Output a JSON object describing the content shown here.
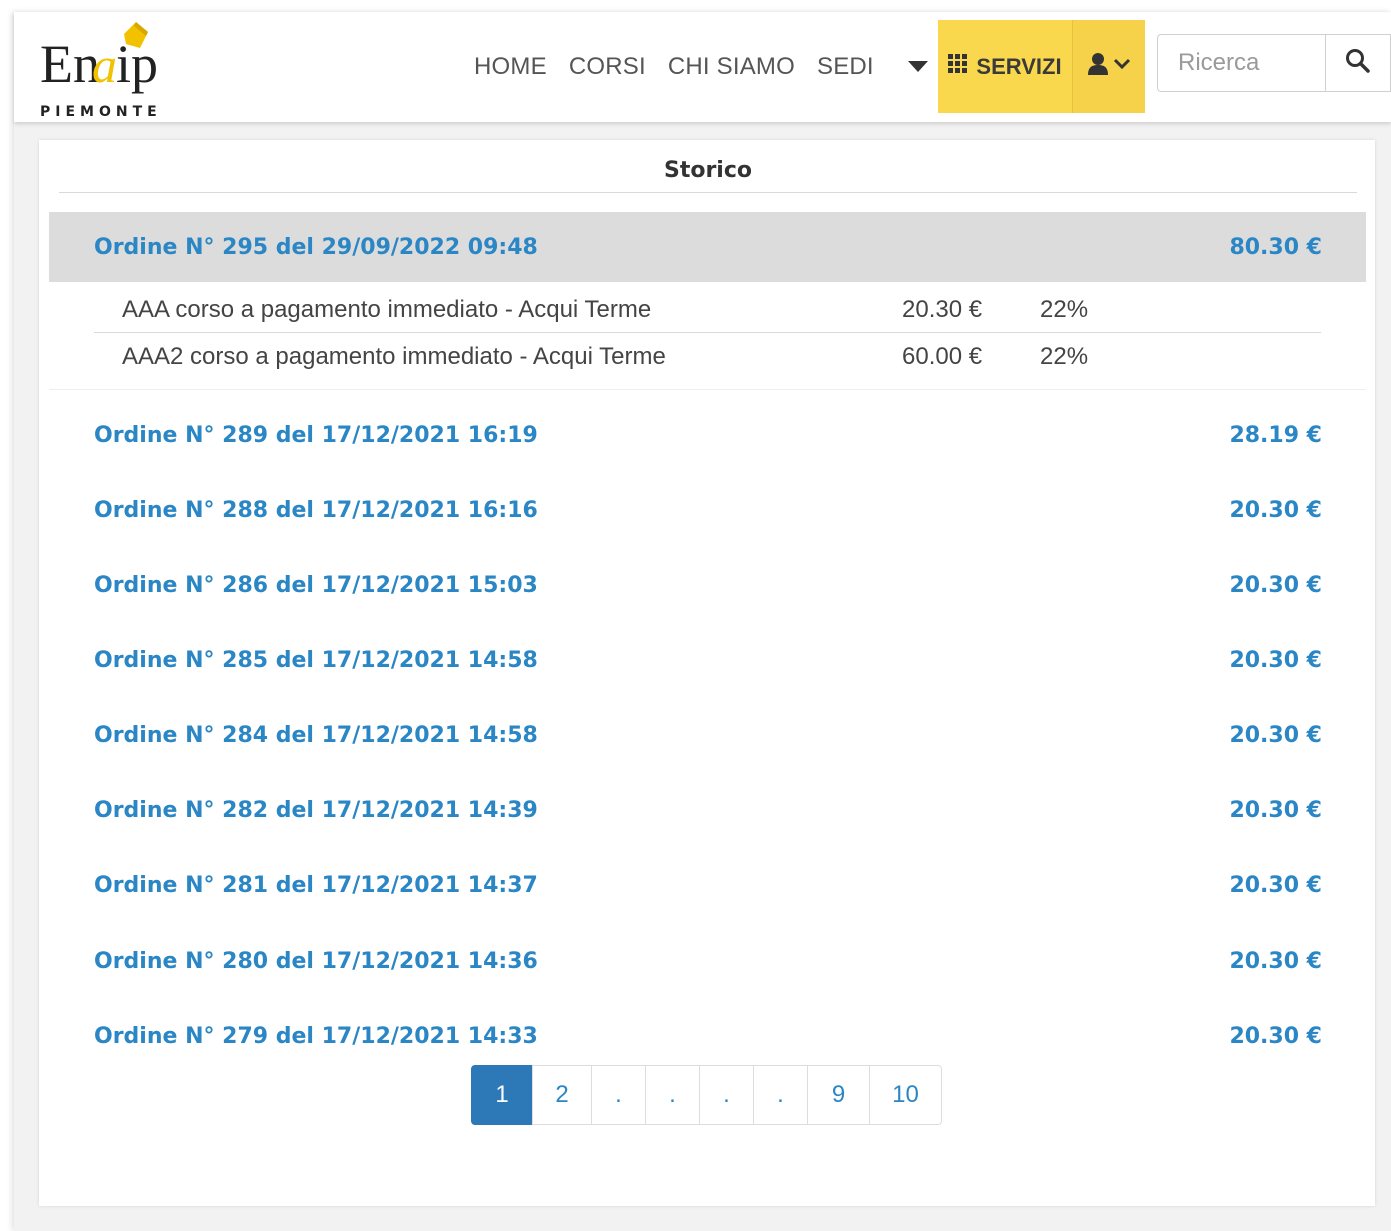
{
  "header": {
    "logo_text": "Enaip",
    "logo_subtitle": "PIEMONTE",
    "nav": [
      {
        "label": "HOME"
      },
      {
        "label": "CORSI"
      },
      {
        "label": "CHI SIAMO"
      },
      {
        "label": "SEDI"
      }
    ],
    "servizi_label": "SERVIZI",
    "search_placeholder": "Ricerca",
    "accent_color": "#fad84e"
  },
  "panel": {
    "title": "Storico",
    "orders": [
      {
        "title": "Ordine N° 295 del 29/09/2022 09:48",
        "amount": "80.30 €",
        "expanded": true,
        "items": [
          {
            "description": "AAA corso a pagamento immediato - Acqui Terme",
            "price": "20.30 €",
            "vat": "22%"
          },
          {
            "description": "AAA2 corso a pagamento immediato - Acqui Terme",
            "price": "60.00 €",
            "vat": "22%"
          }
        ]
      },
      {
        "title": "Ordine N° 289 del 17/12/2021 16:19",
        "amount": "28.19 €"
      },
      {
        "title": "Ordine N° 288 del 17/12/2021 16:16",
        "amount": "20.30 €"
      },
      {
        "title": "Ordine N° 286 del 17/12/2021 15:03",
        "amount": "20.30 €"
      },
      {
        "title": "Ordine N° 285 del 17/12/2021 14:58",
        "amount": "20.30 €"
      },
      {
        "title": "Ordine N° 284 del 17/12/2021 14:58",
        "amount": "20.30 €"
      },
      {
        "title": "Ordine N° 282 del 17/12/2021 14:39",
        "amount": "20.30 €"
      },
      {
        "title": "Ordine N° 281 del 17/12/2021 14:37",
        "amount": "20.30 €"
      },
      {
        "title": "Ordine N° 280 del 17/12/2021 14:36",
        "amount": "20.30 €"
      },
      {
        "title": "Ordine N° 279 del 17/12/2021 14:33",
        "amount": "20.30 €"
      }
    ]
  },
  "pagination": {
    "pages": [
      "1",
      "2",
      ".",
      ".",
      ".",
      ".",
      "9",
      "10"
    ],
    "current": "1"
  },
  "colors": {
    "link": "#2a86c4",
    "active_page": "#2d79b7",
    "selected_row": "#dcdcdc"
  },
  "icons": [
    "grid-icon",
    "user-icon",
    "chevron-down-icon",
    "caret-down-icon",
    "search-icon"
  ]
}
